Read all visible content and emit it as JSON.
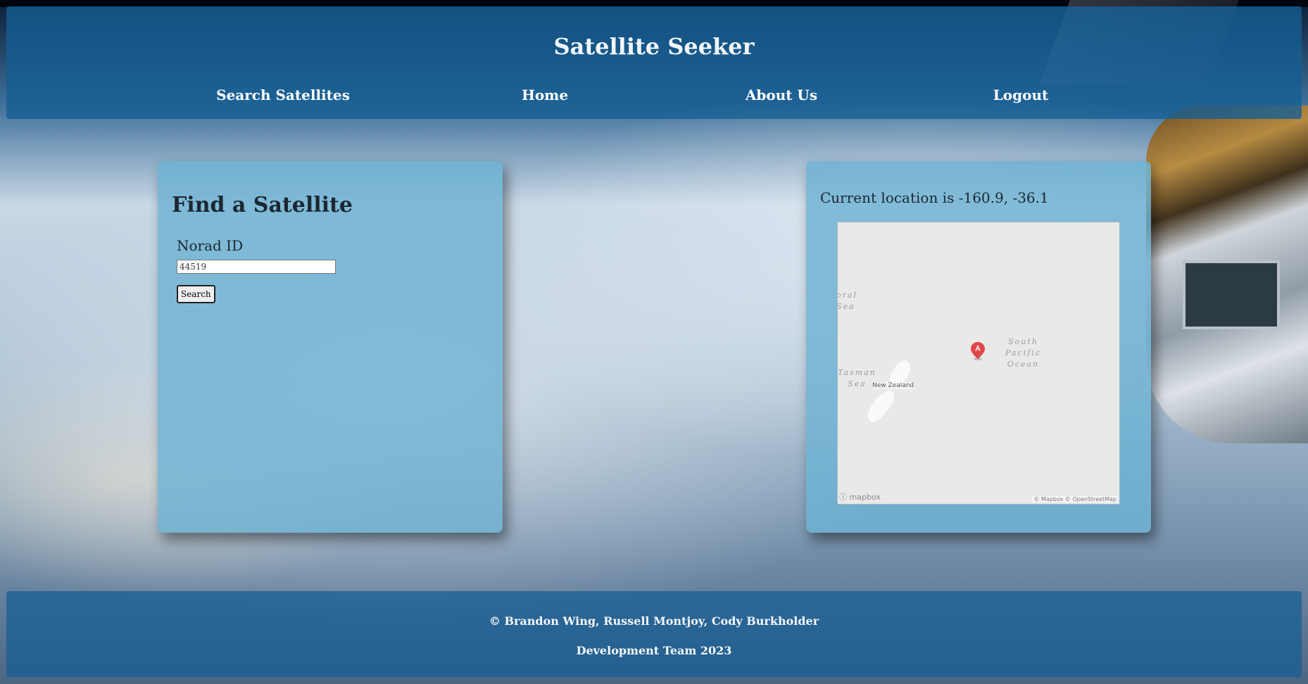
{
  "header": {
    "title": "Satellite Seeker",
    "nav": [
      {
        "label": "Search Satellites"
      },
      {
        "label": "Home"
      },
      {
        "label": "About Us"
      },
      {
        "label": "Logout"
      }
    ]
  },
  "search_card": {
    "title": "Find a Satellite",
    "field_label": "Norad ID",
    "input_value": "44519",
    "button_label": "Search"
  },
  "location_card": {
    "text": "Current location is -160.9, -36.1",
    "map": {
      "labels": {
        "coral_sea": "oral\nSea",
        "tasman_sea": "Tasman\nSea",
        "new_zealand": "New Zealand",
        "south_pacific": "South\nPacific\nOcean"
      },
      "logo": "mapbox",
      "attribution": "© Mapbox © OpenStreetMap",
      "marker_color": "#e0474c",
      "marker_icon": "marker-pin-icon"
    }
  },
  "footer": {
    "line1": "© Brandon Wing, Russell Montjoy, Cody Burkholder",
    "line2": "Development Team 2023"
  },
  "colors": {
    "header_bg": "#155d94",
    "card_bg": "#6eb2d3"
  }
}
